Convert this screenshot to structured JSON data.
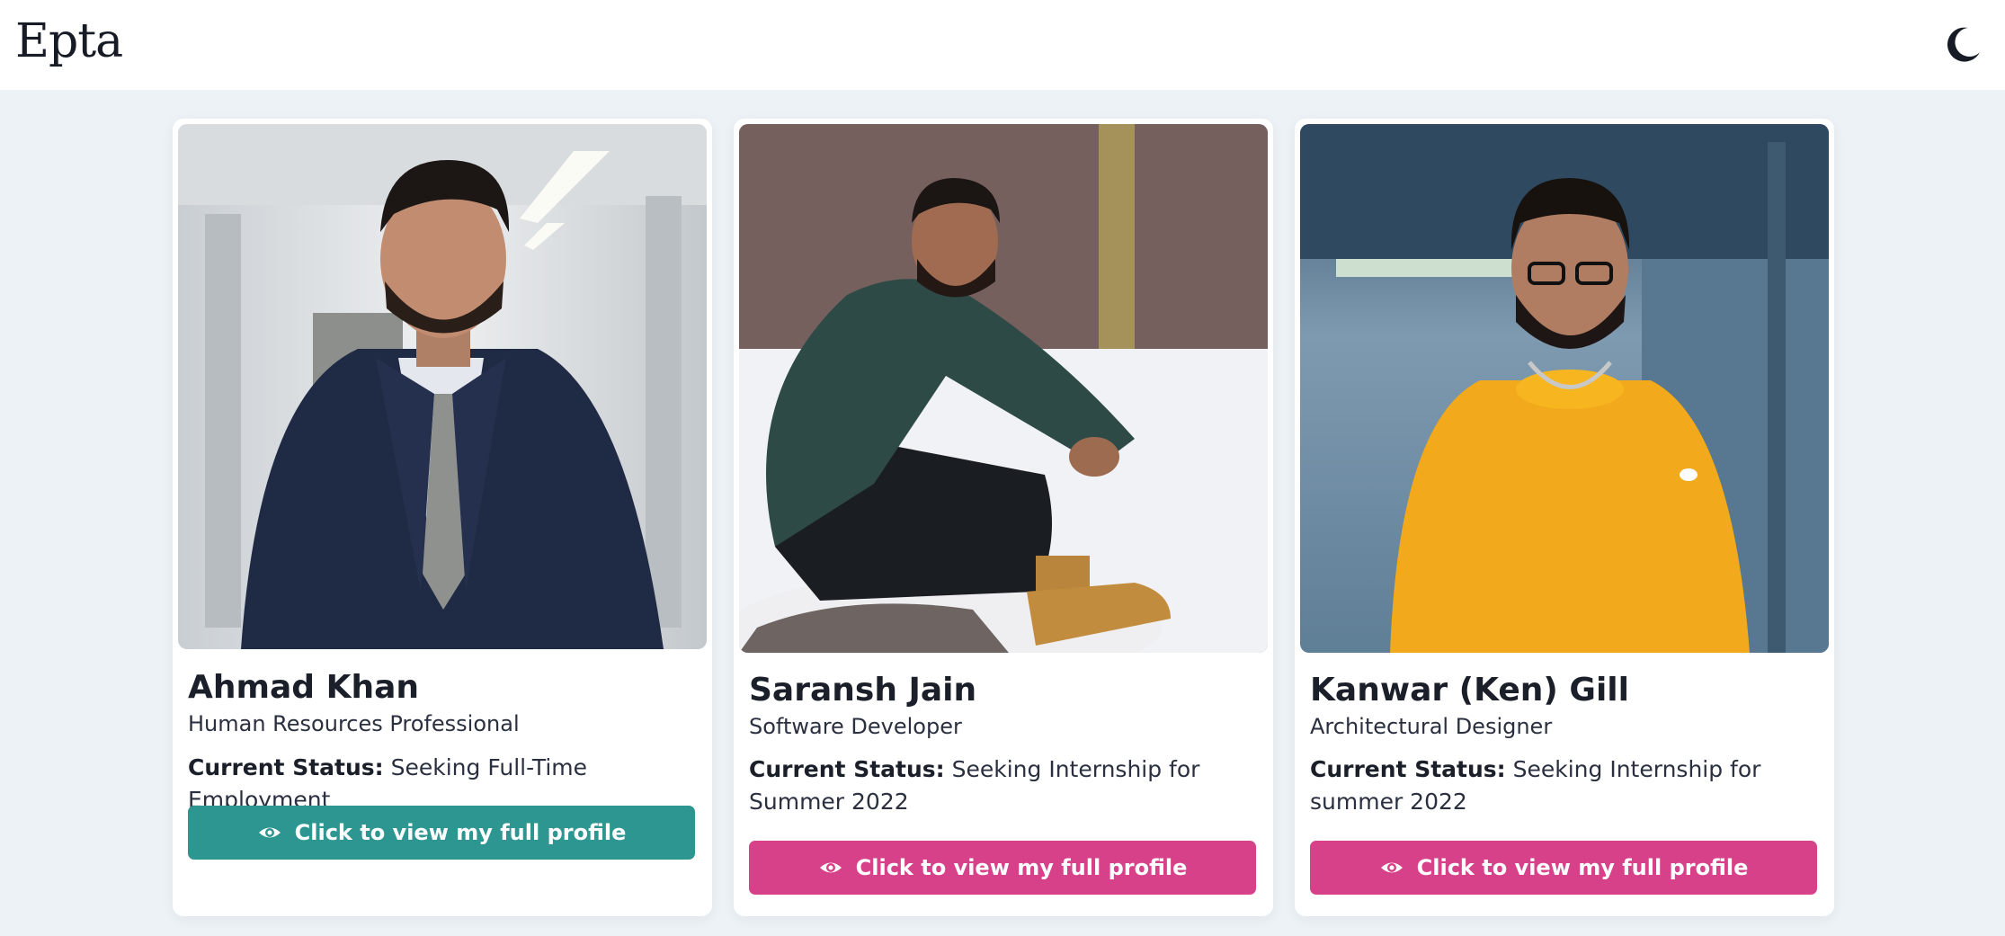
{
  "header": {
    "logo_text": "Epta",
    "theme_toggle_icon": "moon-icon"
  },
  "profiles": [
    {
      "name": "Ahmad Khan",
      "role": "Human Resources Professional",
      "status_label": "Current Status:",
      "status_value": "Seeking Full-Time Employment",
      "button_label": "Click to view my full profile",
      "button_icon": "eye-icon",
      "button_color": "#2e9690"
    },
    {
      "name": "Saransh Jain",
      "role": "Software Developer",
      "status_label": "Current Status:",
      "status_value": "Seeking Internship for Summer 2022",
      "button_label": "Click to view my full profile",
      "button_icon": "eye-icon",
      "button_color": "#d6418a"
    },
    {
      "name": "Kanwar (Ken) Gill",
      "role": "Architectural Designer",
      "status_label": "Current Status:",
      "status_value": "Seeking Internship for summer 2022",
      "button_label": "Click to view my full profile",
      "button_icon": "eye-icon",
      "button_color": "#d6418a"
    }
  ]
}
